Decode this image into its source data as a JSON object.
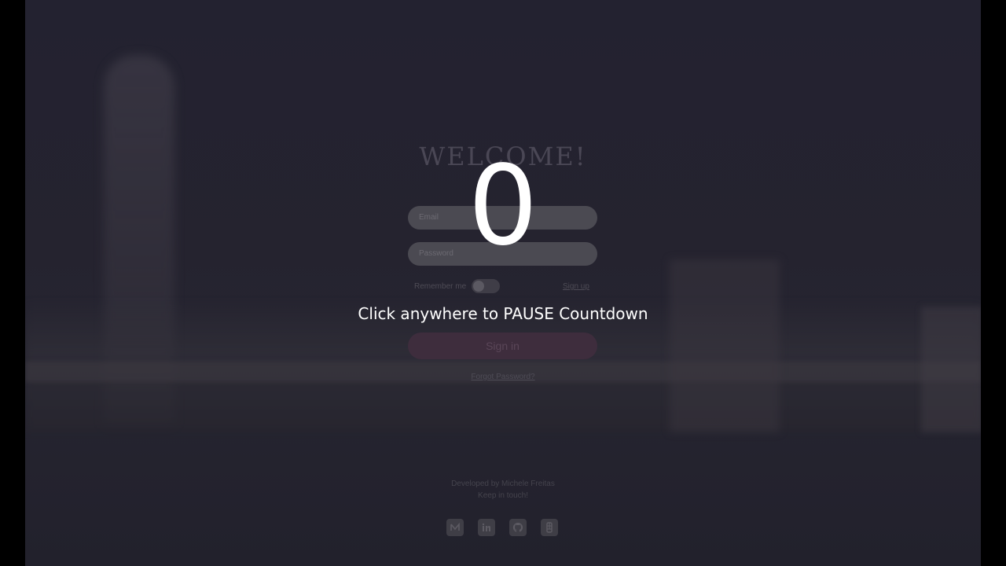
{
  "login": {
    "title": "WELCOME!",
    "username_placeholder": "Email",
    "password_placeholder": "Password",
    "remember_label": "Remember me",
    "signup_label": "Sign up",
    "signin_label": "Sign in",
    "forgot_label": "Forgot Password?"
  },
  "footer": {
    "developed_by": "Developed by Michele Freitas",
    "keep_in_touch": "Keep in touch!",
    "socials": [
      "medium-icon",
      "linkedin-icon",
      "github-icon",
      "figma-icon"
    ]
  },
  "overlay": {
    "countdown_value": "0",
    "hint": "Click anywhere to PAUSE Countdown"
  },
  "colors": {
    "overlay_text": "#ffffff",
    "signin_button": "#3e2d3d",
    "background": "#000000"
  }
}
